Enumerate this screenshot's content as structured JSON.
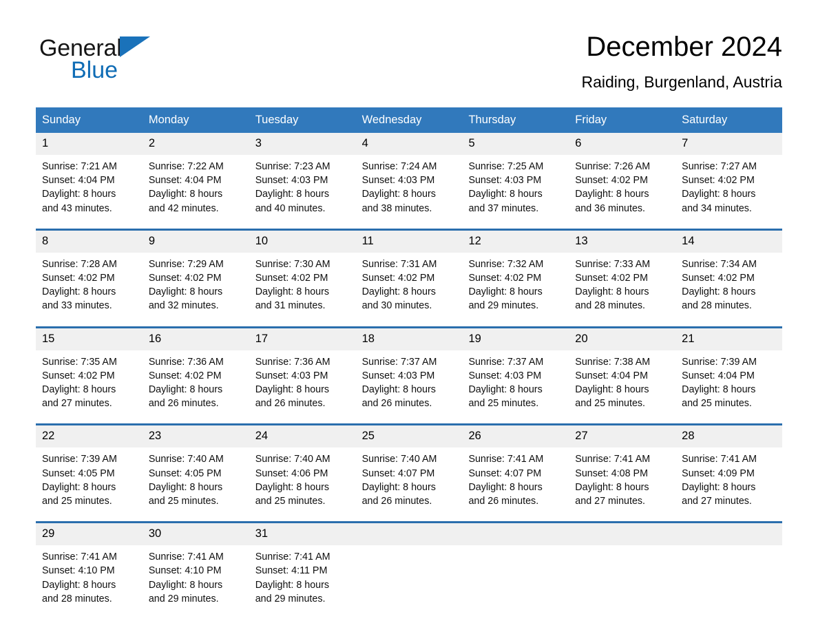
{
  "brand": {
    "word1": "General",
    "word2": "Blue",
    "triangle_color": "#1a72ba",
    "blue_color": "#0f6cb5"
  },
  "header": {
    "title": "December 2024",
    "subtitle": "Raiding, Burgenland, Austria"
  },
  "theme": {
    "header_bg": "#3179bc",
    "week_rule": "#2a6ead",
    "datestrip_bg": "#f0f0f0",
    "page_bg": "#ffffff"
  },
  "weekdays": [
    "Sunday",
    "Monday",
    "Tuesday",
    "Wednesday",
    "Thursday",
    "Friday",
    "Saturday"
  ],
  "weeks": [
    {
      "days": [
        {
          "num": "1",
          "sunrise": "Sunrise: 7:21 AM",
          "sunset": "Sunset: 4:04 PM",
          "daylight1": "Daylight: 8 hours",
          "daylight2": "and 43 minutes."
        },
        {
          "num": "2",
          "sunrise": "Sunrise: 7:22 AM",
          "sunset": "Sunset: 4:04 PM",
          "daylight1": "Daylight: 8 hours",
          "daylight2": "and 42 minutes."
        },
        {
          "num": "3",
          "sunrise": "Sunrise: 7:23 AM",
          "sunset": "Sunset: 4:03 PM",
          "daylight1": "Daylight: 8 hours",
          "daylight2": "and 40 minutes."
        },
        {
          "num": "4",
          "sunrise": "Sunrise: 7:24 AM",
          "sunset": "Sunset: 4:03 PM",
          "daylight1": "Daylight: 8 hours",
          "daylight2": "and 38 minutes."
        },
        {
          "num": "5",
          "sunrise": "Sunrise: 7:25 AM",
          "sunset": "Sunset: 4:03 PM",
          "daylight1": "Daylight: 8 hours",
          "daylight2": "and 37 minutes."
        },
        {
          "num": "6",
          "sunrise": "Sunrise: 7:26 AM",
          "sunset": "Sunset: 4:02 PM",
          "daylight1": "Daylight: 8 hours",
          "daylight2": "and 36 minutes."
        },
        {
          "num": "7",
          "sunrise": "Sunrise: 7:27 AM",
          "sunset": "Sunset: 4:02 PM",
          "daylight1": "Daylight: 8 hours",
          "daylight2": "and 34 minutes."
        }
      ]
    },
    {
      "days": [
        {
          "num": "8",
          "sunrise": "Sunrise: 7:28 AM",
          "sunset": "Sunset: 4:02 PM",
          "daylight1": "Daylight: 8 hours",
          "daylight2": "and 33 minutes."
        },
        {
          "num": "9",
          "sunrise": "Sunrise: 7:29 AM",
          "sunset": "Sunset: 4:02 PM",
          "daylight1": "Daylight: 8 hours",
          "daylight2": "and 32 minutes."
        },
        {
          "num": "10",
          "sunrise": "Sunrise: 7:30 AM",
          "sunset": "Sunset: 4:02 PM",
          "daylight1": "Daylight: 8 hours",
          "daylight2": "and 31 minutes."
        },
        {
          "num": "11",
          "sunrise": "Sunrise: 7:31 AM",
          "sunset": "Sunset: 4:02 PM",
          "daylight1": "Daylight: 8 hours",
          "daylight2": "and 30 minutes."
        },
        {
          "num": "12",
          "sunrise": "Sunrise: 7:32 AM",
          "sunset": "Sunset: 4:02 PM",
          "daylight1": "Daylight: 8 hours",
          "daylight2": "and 29 minutes."
        },
        {
          "num": "13",
          "sunrise": "Sunrise: 7:33 AM",
          "sunset": "Sunset: 4:02 PM",
          "daylight1": "Daylight: 8 hours",
          "daylight2": "and 28 minutes."
        },
        {
          "num": "14",
          "sunrise": "Sunrise: 7:34 AM",
          "sunset": "Sunset: 4:02 PM",
          "daylight1": "Daylight: 8 hours",
          "daylight2": "and 28 minutes."
        }
      ]
    },
    {
      "days": [
        {
          "num": "15",
          "sunrise": "Sunrise: 7:35 AM",
          "sunset": "Sunset: 4:02 PM",
          "daylight1": "Daylight: 8 hours",
          "daylight2": "and 27 minutes."
        },
        {
          "num": "16",
          "sunrise": "Sunrise: 7:36 AM",
          "sunset": "Sunset: 4:02 PM",
          "daylight1": "Daylight: 8 hours",
          "daylight2": "and 26 minutes."
        },
        {
          "num": "17",
          "sunrise": "Sunrise: 7:36 AM",
          "sunset": "Sunset: 4:03 PM",
          "daylight1": "Daylight: 8 hours",
          "daylight2": "and 26 minutes."
        },
        {
          "num": "18",
          "sunrise": "Sunrise: 7:37 AM",
          "sunset": "Sunset: 4:03 PM",
          "daylight1": "Daylight: 8 hours",
          "daylight2": "and 26 minutes."
        },
        {
          "num": "19",
          "sunrise": "Sunrise: 7:37 AM",
          "sunset": "Sunset: 4:03 PM",
          "daylight1": "Daylight: 8 hours",
          "daylight2": "and 25 minutes."
        },
        {
          "num": "20",
          "sunrise": "Sunrise: 7:38 AM",
          "sunset": "Sunset: 4:04 PM",
          "daylight1": "Daylight: 8 hours",
          "daylight2": "and 25 minutes."
        },
        {
          "num": "21",
          "sunrise": "Sunrise: 7:39 AM",
          "sunset": "Sunset: 4:04 PM",
          "daylight1": "Daylight: 8 hours",
          "daylight2": "and 25 minutes."
        }
      ]
    },
    {
      "days": [
        {
          "num": "22",
          "sunrise": "Sunrise: 7:39 AM",
          "sunset": "Sunset: 4:05 PM",
          "daylight1": "Daylight: 8 hours",
          "daylight2": "and 25 minutes."
        },
        {
          "num": "23",
          "sunrise": "Sunrise: 7:40 AM",
          "sunset": "Sunset: 4:05 PM",
          "daylight1": "Daylight: 8 hours",
          "daylight2": "and 25 minutes."
        },
        {
          "num": "24",
          "sunrise": "Sunrise: 7:40 AM",
          "sunset": "Sunset: 4:06 PM",
          "daylight1": "Daylight: 8 hours",
          "daylight2": "and 25 minutes."
        },
        {
          "num": "25",
          "sunrise": "Sunrise: 7:40 AM",
          "sunset": "Sunset: 4:07 PM",
          "daylight1": "Daylight: 8 hours",
          "daylight2": "and 26 minutes."
        },
        {
          "num": "26",
          "sunrise": "Sunrise: 7:41 AM",
          "sunset": "Sunset: 4:07 PM",
          "daylight1": "Daylight: 8 hours",
          "daylight2": "and 26 minutes."
        },
        {
          "num": "27",
          "sunrise": "Sunrise: 7:41 AM",
          "sunset": "Sunset: 4:08 PM",
          "daylight1": "Daylight: 8 hours",
          "daylight2": "and 27 minutes."
        },
        {
          "num": "28",
          "sunrise": "Sunrise: 7:41 AM",
          "sunset": "Sunset: 4:09 PM",
          "daylight1": "Daylight: 8 hours",
          "daylight2": "and 27 minutes."
        }
      ]
    },
    {
      "days": [
        {
          "num": "29",
          "sunrise": "Sunrise: 7:41 AM",
          "sunset": "Sunset: 4:10 PM",
          "daylight1": "Daylight: 8 hours",
          "daylight2": "and 28 minutes."
        },
        {
          "num": "30",
          "sunrise": "Sunrise: 7:41 AM",
          "sunset": "Sunset: 4:10 PM",
          "daylight1": "Daylight: 8 hours",
          "daylight2": "and 29 minutes."
        },
        {
          "num": "31",
          "sunrise": "Sunrise: 7:41 AM",
          "sunset": "Sunset: 4:11 PM",
          "daylight1": "Daylight: 8 hours",
          "daylight2": "and 29 minutes."
        },
        {
          "num": "",
          "sunrise": "",
          "sunset": "",
          "daylight1": "",
          "daylight2": ""
        },
        {
          "num": "",
          "sunrise": "",
          "sunset": "",
          "daylight1": "",
          "daylight2": ""
        },
        {
          "num": "",
          "sunrise": "",
          "sunset": "",
          "daylight1": "",
          "daylight2": ""
        },
        {
          "num": "",
          "sunrise": "",
          "sunset": "",
          "daylight1": "",
          "daylight2": ""
        }
      ]
    }
  ]
}
